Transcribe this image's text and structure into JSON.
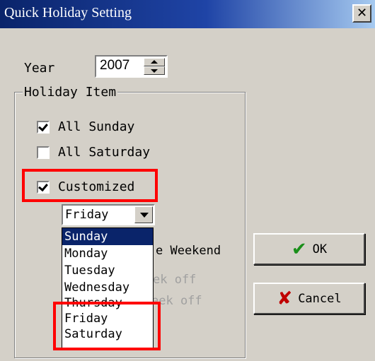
{
  "window": {
    "title": "Quick Holiday Setting",
    "close_label": "✕"
  },
  "year": {
    "label": "Year",
    "value": "2007"
  },
  "holiday_item": {
    "legend": "Holiday Item",
    "all_sunday": {
      "label": "All Sunday",
      "checked": true
    },
    "all_saturday": {
      "label": "All Saturday",
      "checked": false
    },
    "customized": {
      "label": "Customized",
      "checked": true
    }
  },
  "combo": {
    "selected": "Friday"
  },
  "dropdown": {
    "options": [
      "Sunday",
      "Monday",
      "Tuesday",
      "Wednesday",
      "Thursday",
      "Friday",
      "Saturday"
    ],
    "highlighted": "Sunday"
  },
  "partially_hidden": {
    "weekend_text": "e Weekend",
    "week_off_1": "ek off",
    "week_off_2": "eek off"
  },
  "buttons": {
    "ok": "OK",
    "cancel": "Cancel",
    "ok_icon": "checkmark-icon",
    "cancel_icon": "x-icon",
    "ok_color": "#1a8f1a",
    "cancel_color": "#c00000"
  },
  "accent": {
    "highlight": "#ff0000",
    "title_bar": "#0a246a"
  }
}
